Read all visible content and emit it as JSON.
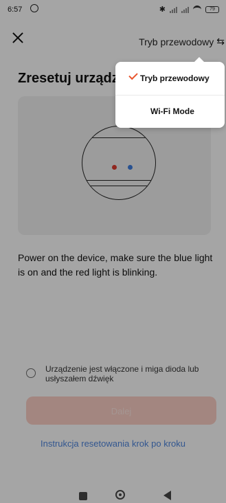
{
  "status": {
    "time": "6:57",
    "battery": "79",
    "bluetooth_glyph": "✱"
  },
  "header": {
    "mode_label": "Tryb przewodowy",
    "swap_glyph": "⇆"
  },
  "main": {
    "title": "Zresetuj urządz",
    "description": "Power on the device, make sure the blue light is on and the red light is blinking.",
    "confirm_label": "Urządzenie jest włączone i miga dioda lub usłyszałem dźwięk",
    "next_button": "Dalej",
    "guide_link": "Instrukcja resetowania krok po kroku"
  },
  "menu": {
    "items": [
      {
        "label": "Tryb przewodowy",
        "selected": true
      },
      {
        "label": "Wi-Fi Mode",
        "selected": false
      }
    ]
  },
  "colors": {
    "accent": "#e9562f",
    "link": "#4a7fd3",
    "led_red": "#d53a2f",
    "led_blue": "#3b78d4"
  }
}
